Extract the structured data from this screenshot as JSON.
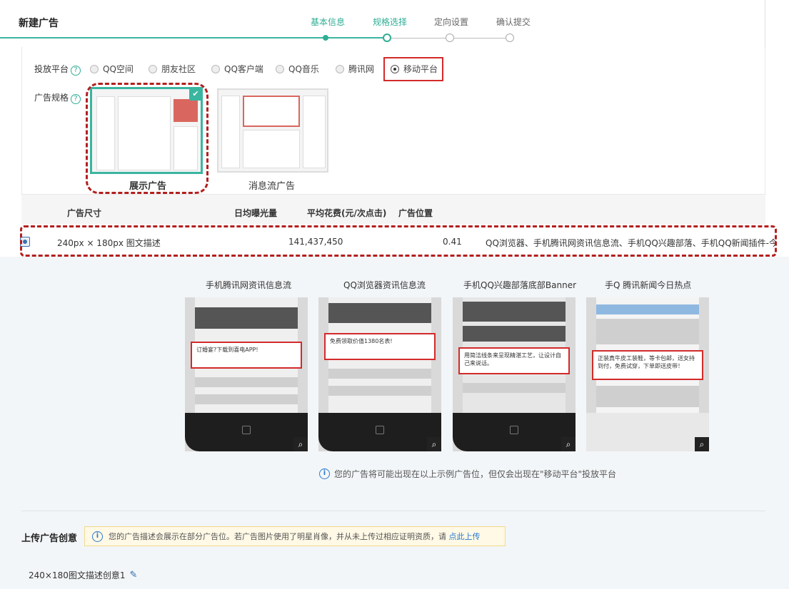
{
  "header": {
    "title": "新建广告",
    "steps": [
      {
        "label": "基本信息",
        "state": "done"
      },
      {
        "label": "规格选择",
        "state": "current"
      },
      {
        "label": "定向设置",
        "state": "todo"
      },
      {
        "label": "确认提交",
        "state": "todo"
      }
    ]
  },
  "platform": {
    "label": "投放平台",
    "help": "?",
    "options": [
      "QQ空间",
      "朋友社区",
      "QQ客户端",
      "QQ音乐",
      "腾讯网",
      "移动平台"
    ],
    "selected": "移动平台"
  },
  "spec": {
    "label": "广告规格",
    "help": "?",
    "cards": [
      {
        "label": "展示广告",
        "selected": true
      },
      {
        "label": "消息流广告",
        "selected": false
      }
    ],
    "check": "✔"
  },
  "table": {
    "headers": [
      "广告尺寸",
      "日均曝光量",
      "平均花费(元/次点击)",
      "广告位置"
    ],
    "row": {
      "size": "240px × 180px 图文描述",
      "impressions": "141,437,450",
      "cost": "0.41",
      "positions": "QQ浏览器、手机腾讯网资讯信息流、手机QQ兴趣部落、手机QQ新闻插件-今日热点"
    }
  },
  "previews": [
    {
      "title": "手机腾讯网资讯信息流",
      "ad_text": "订婚宴?下载到喜电APP!"
    },
    {
      "title": "QQ浏览器资讯信息流",
      "ad_text": "免费领取价值1380名表!"
    },
    {
      "title": "手机QQ兴趣部落底部Banner",
      "ad_text": "用简洁线条来呈现精湛工艺，让设计自己来说话。"
    },
    {
      "title": "手Q 腾讯新闻今日热点",
      "ad_text": "正装真牛皮工装鞋，等卡包邮，送女持到付，免费试穿，下单即送皮带！"
    }
  ],
  "preview_notice": "您的广告将可能出现在以上示例广告位，但仅会出现在\"移动平台\"投放平台",
  "upload": {
    "title": "上传广告创意",
    "tip": "您的广告描述会展示在部分广告位。若广告图片使用了明星肖像，并从未上传过相应证明资质，请",
    "tip_link": "点此上传",
    "creative_name": "240×180图文描述创意1"
  },
  "colors": {
    "accent": "#2fae94",
    "highlight": "#d32a2a",
    "link": "#2a7ad0"
  }
}
